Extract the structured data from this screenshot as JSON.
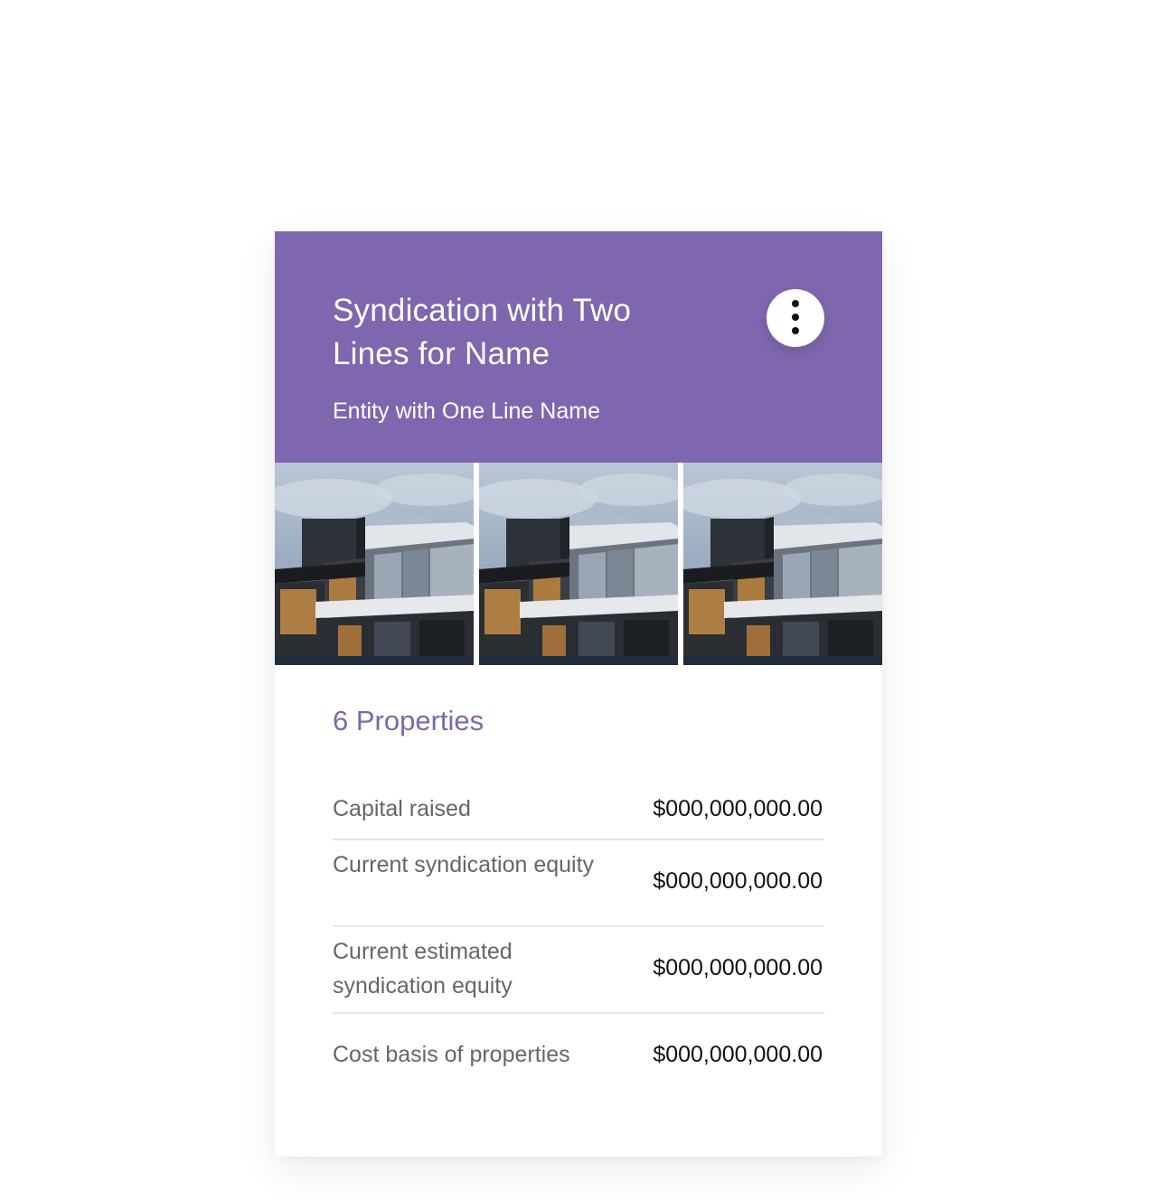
{
  "header": {
    "title": "Syndication with Two Lines for Name",
    "subtitle": "Entity with One Line Name",
    "background_color": "#7e67ae",
    "menu_icon": "more-vertical-icon"
  },
  "gallery": {
    "photos": [
      {
        "alt": "property-photo"
      },
      {
        "alt": "property-photo"
      },
      {
        "alt": "property-photo"
      }
    ]
  },
  "summary": {
    "count_label": "6 Properties",
    "accent_color": "#7e67ae"
  },
  "stats": [
    {
      "label": "Capital raised",
      "value": "$000,000,000.00"
    },
    {
      "label": "Current syndication equity",
      "value": "$000,000,000.00"
    },
    {
      "label": "Current estimated syndication equity",
      "value": "$000,000,000.00"
    },
    {
      "label": "Cost basis of properties",
      "value": "$000,000,000.00"
    }
  ]
}
